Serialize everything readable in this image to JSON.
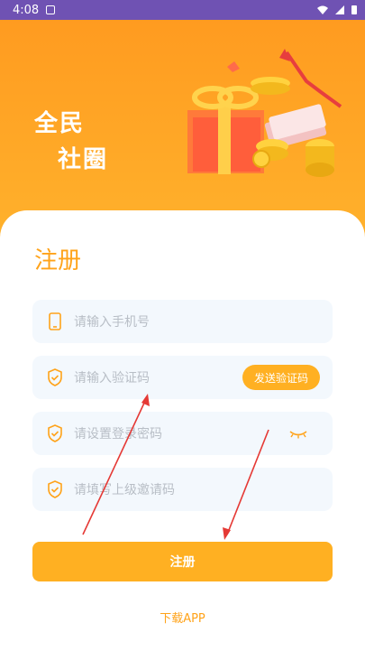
{
  "status_bar": {
    "time": "4:08"
  },
  "hero": {
    "title_line1": "全民",
    "title_line2": "社圈"
  },
  "form": {
    "title": "注册",
    "phone_placeholder": "请输入手机号",
    "code_placeholder": "请输入验证码",
    "send_code_label": "发送验证码",
    "password_placeholder": "请设置登录密码",
    "invite_placeholder": "请填写上级邀请码",
    "submit_label": "注册",
    "download_label": "下载APP"
  },
  "colors": {
    "accent": "#ffb022",
    "accent_text": "#ffa31a",
    "status_bar": "#6f52b3",
    "annotation": "#e53935"
  }
}
